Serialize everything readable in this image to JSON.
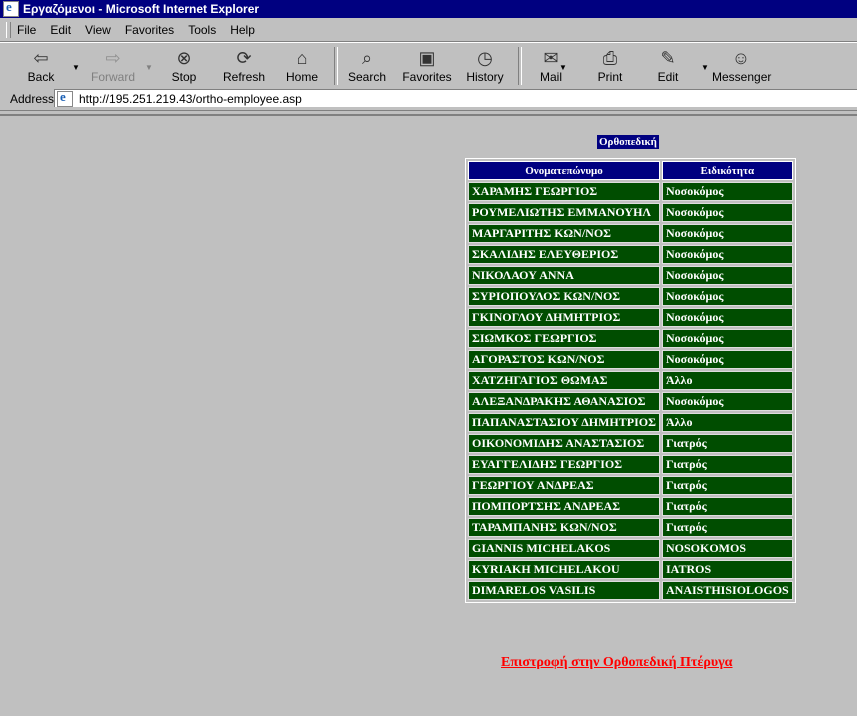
{
  "window": {
    "title": "Εργαζόμενοι - Microsoft Internet Explorer"
  },
  "menu": [
    "File",
    "Edit",
    "View",
    "Favorites",
    "Tools",
    "Help"
  ],
  "toolbar": {
    "back": "Back",
    "forward": "Forward",
    "stop": "Stop",
    "refresh": "Refresh",
    "home": "Home",
    "search": "Search",
    "favorites": "Favorites",
    "history": "History",
    "mail": "Mail",
    "print": "Print",
    "edit": "Edit",
    "messenger": "Messenger"
  },
  "address": {
    "label": "Address",
    "url": "http://195.251.219.43/ortho-employee.asp"
  },
  "page": {
    "caption": "Ορθοπεδική",
    "headers": {
      "name": "Ονοματεπώνυμο",
      "specialty": "Ειδικότητα"
    },
    "rows": [
      {
        "name": "ΧΑΡΑΜΗΣ ΓΕΩΡΓΙΟΣ",
        "specialty": "Νοσοκόμος"
      },
      {
        "name": "ΡΟΥΜΕΛΙΩΤΗΣ ΕΜΜΑΝΟΥΗΛ",
        "specialty": "Νοσοκόμος"
      },
      {
        "name": "ΜΑΡΓΑΡΙΤΗΣ ΚΩΝ/ΝΟΣ",
        "specialty": "Νοσοκόμος"
      },
      {
        "name": "ΣΚΑΛΙΔΗΣ ΕΛΕΥΘΕΡΙΟΣ",
        "specialty": "Νοσοκόμος"
      },
      {
        "name": "ΝΙΚΟΛΑΟΥ ΑΝΝΑ",
        "specialty": "Νοσοκόμος"
      },
      {
        "name": "ΣΥΡΙΟΠΟΥΛΟΣ ΚΩΝ/ΝΟΣ",
        "specialty": "Νοσοκόμος"
      },
      {
        "name": "ΓΚΙΝΟΓΛΟΥ ΔΗΜΗΤΡΙΟΣ",
        "specialty": "Νοσοκόμος"
      },
      {
        "name": "ΣΙΩΜΚΟΣ ΓΕΩΡΓΙΟΣ",
        "specialty": "Νοσοκόμος"
      },
      {
        "name": "ΑΓΟΡΑΣΤΟΣ ΚΩΝ/ΝΟΣ",
        "specialty": "Νοσοκόμος"
      },
      {
        "name": "ΧΑΤΖΗΓΑΓΙΟΣ ΘΩΜΑΣ",
        "specialty": "Άλλο"
      },
      {
        "name": "ΑΛΕΞΑΝΔΡΑΚΗΣ ΑΘΑΝΑΣΙΟΣ",
        "specialty": "Νοσοκόμος"
      },
      {
        "name": "ΠΑΠΑΝΑΣΤΑΣΙΟΥ ΔΗΜΗΤΡΙΟΣ",
        "specialty": "Άλλο"
      },
      {
        "name": "ΟΙΚΟΝΟΜΙΔΗΣ ΑΝΑΣΤΑΣΙΟΣ",
        "specialty": "Γιατρός"
      },
      {
        "name": "ΕΥΑΓΓΕΛΙΔΗΣ ΓΕΩΡΓΙΟΣ",
        "specialty": "Γιατρός"
      },
      {
        "name": "ΓΕΩΡΓΙΟΥ ΑΝΔΡΕΑΣ",
        "specialty": "Γιατρός"
      },
      {
        "name": "ΠΟΜΠΟΡΤΣΗΣ ΑΝΔΡΕΑΣ",
        "specialty": "Γιατρός"
      },
      {
        "name": "ΤΑΡΑΜΠΑΝΗΣ ΚΩΝ/ΝΟΣ",
        "specialty": "Γιατρός"
      },
      {
        "name": "GIANNIS MICHELAKOS",
        "specialty": "NOSOKOMOS"
      },
      {
        "name": "KYRIAKH MICHELAKOU",
        "specialty": "IATROS"
      },
      {
        "name": "DIMARELOS VASILIS",
        "specialty": "ANAISTHISIOLOGOS"
      }
    ],
    "back_link": "Επιστροφή στην Ορθοπεδική Πτέρυγα"
  },
  "colors": {
    "header_bg": "#000080",
    "row_bg": "#004d00",
    "link": "#ff0000"
  }
}
